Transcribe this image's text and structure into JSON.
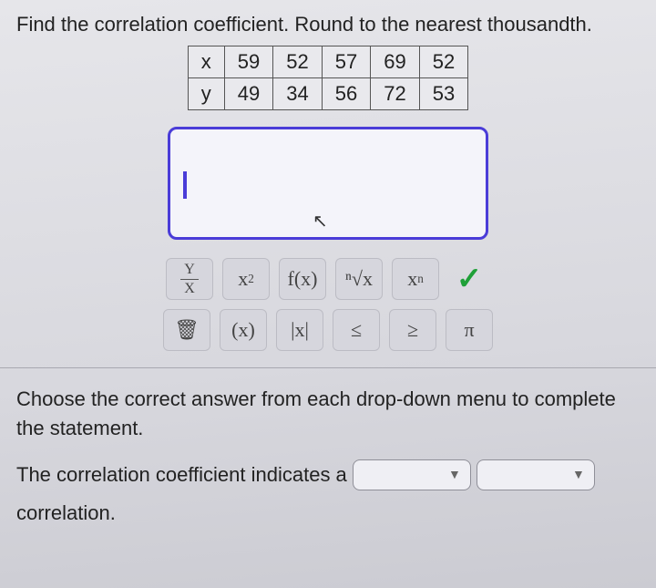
{
  "prompt": "Find the correlation coefficient. Round to the nearest thousandth.",
  "table": {
    "rows": [
      {
        "label": "x",
        "values": [
          "59",
          "52",
          "57",
          "69",
          "52"
        ]
      },
      {
        "label": "y",
        "values": [
          "49",
          "34",
          "56",
          "72",
          "53"
        ]
      }
    ]
  },
  "toolbar": {
    "row1": {
      "fraction_top": "Y",
      "fraction_bottom": "X",
      "xsquared_base": "x",
      "xsquared_sup": "2",
      "fx": "f(x)",
      "nthroot": "ⁿ√x",
      "xsub_base": "x",
      "xsub_sub": "n",
      "check": "✓"
    },
    "row2": {
      "trash": "🗑",
      "paren": "(x)",
      "abs": "|x|",
      "le": "≤",
      "ge": "≥",
      "pi": "π"
    }
  },
  "instruction": "Choose the correct answer from each drop-down menu to complete the statement.",
  "sentence": {
    "part1": "The correlation coefficient indicates a",
    "part2": "correlation.",
    "dropdown_caret": "▼"
  },
  "chart_data": {
    "type": "table",
    "title": "Paired data for correlation coefficient",
    "columns": [
      "x",
      "y"
    ],
    "rows": [
      {
        "x": 59,
        "y": 49
      },
      {
        "x": 52,
        "y": 34
      },
      {
        "x": 57,
        "y": 56
      },
      {
        "x": 69,
        "y": 72
      },
      {
        "x": 52,
        "y": 53
      }
    ]
  }
}
